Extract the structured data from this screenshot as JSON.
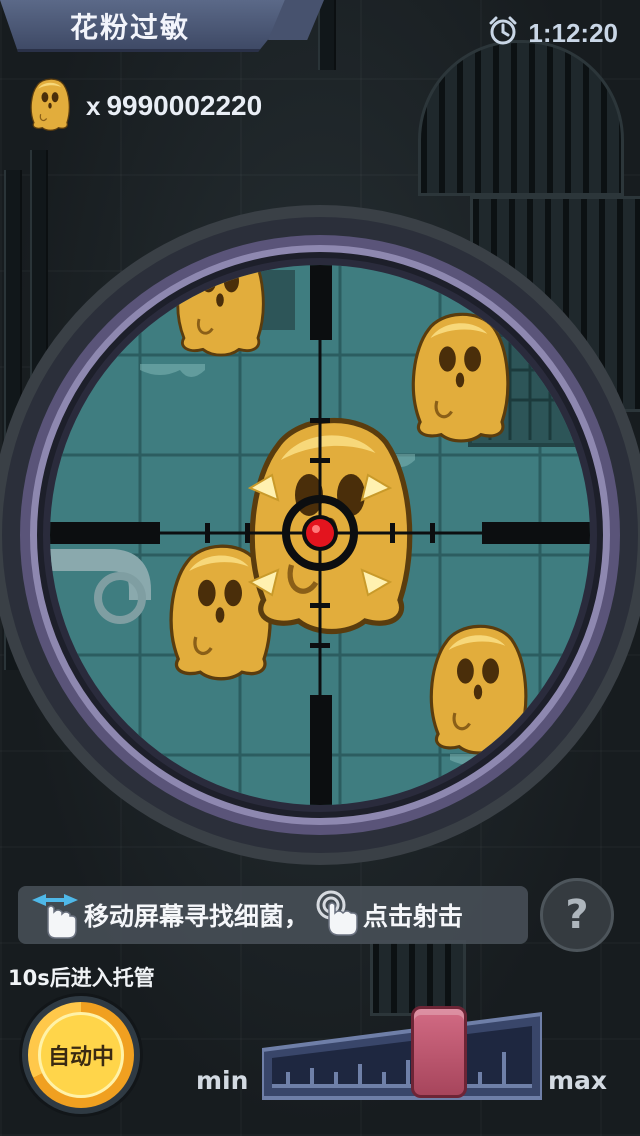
{
  "title": "花粉过敏",
  "timer": {
    "icon": "alarm-clock-icon",
    "value": "1:12:20"
  },
  "counter": {
    "icon": "pollen-germ-icon",
    "prefix": "x",
    "value": "9990002220"
  },
  "hint": {
    "move_icon": "swipe-hand-icon",
    "move_text": "移动屏幕寻找细菌，",
    "tap_icon": "tap-hand-icon",
    "tap_text": "点击射击"
  },
  "help_button": {
    "icon": "question-icon",
    "label": "?"
  },
  "auto_notice": "10s后进入托管",
  "auto_button": {
    "label": "自动中",
    "progress": 0.68
  },
  "power_meter": {
    "min_label": "min",
    "max_label": "max",
    "level": 0.68
  },
  "colors": {
    "scope_rim": "#8e88b0",
    "crosshair_dot": "#e3141e",
    "germ": "#e2ad3c",
    "auto_button": "#ffc84a",
    "meter_handle": "#c25a73"
  }
}
